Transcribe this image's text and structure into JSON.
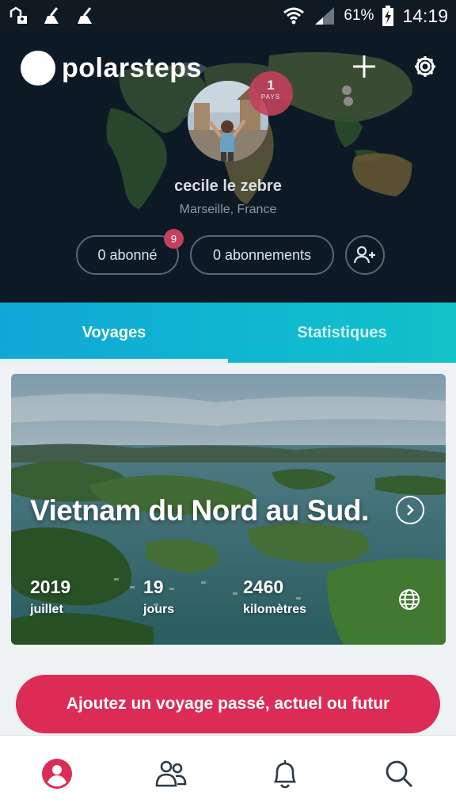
{
  "status_bar": {
    "battery": "61%",
    "time": "14:19",
    "icons": [
      "notification-app-icon",
      "cleaner-icon",
      "cleaner-icon",
      "wifi-icon",
      "signal-icon",
      "battery-charging-icon"
    ]
  },
  "app": {
    "brand": "polarsteps",
    "icons": {
      "add": "plus-icon",
      "settings": "gear-icon"
    }
  },
  "profile": {
    "name": "cecile le zebre",
    "location": "Marseille, France",
    "countries_count": "1",
    "countries_label": "PAYS",
    "followers_label": "0 abonné",
    "following_label": "0 abonnements",
    "notification_count": "9"
  },
  "tabs": [
    {
      "label": "Voyages",
      "active": true
    },
    {
      "label": "Statistiques",
      "active": false
    }
  ],
  "trip": {
    "title": "Vietnam du Nord au Sud.",
    "stats": [
      {
        "value": "2019",
        "label": "juillet"
      },
      {
        "value": "19",
        "label": "jours"
      },
      {
        "value": "2460",
        "label": "kilomètres"
      }
    ]
  },
  "cta": {
    "label": "Ajoutez un voyage passé, actuel ou futur"
  },
  "bottom_nav": [
    "profile-icon",
    "people-icon",
    "bell-icon",
    "search-icon"
  ],
  "colors": {
    "accent": "#dc2c56",
    "tab_bar": "#10a7d6",
    "header_bg": "#0d1b26"
  }
}
